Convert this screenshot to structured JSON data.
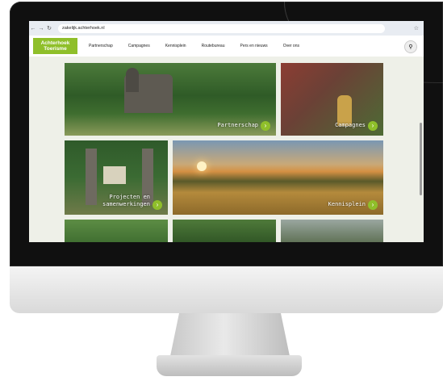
{
  "browser": {
    "url": "zakelijk.achterhoek.nl",
    "back_icon": "arrow-left",
    "forward_icon": "arrow-right",
    "reload_icon": "reload",
    "bookmark_icon": "star"
  },
  "site": {
    "logo_line1": "Achterhoek",
    "logo_line2": "Toerisme",
    "brand_color": "#8fbf2a",
    "menu": [
      {
        "label": "Partnerschap"
      },
      {
        "label": "Campagnes"
      },
      {
        "label": "Kennisplein"
      },
      {
        "label": "Routebureau"
      },
      {
        "label": "Pers en nieuws"
      },
      {
        "label": "Over ons"
      }
    ],
    "search_icon": "search"
  },
  "tiles": [
    {
      "label": "Partnerschap"
    },
    {
      "label": "Campagnes"
    },
    {
      "label": "Projecten en samenwerkingen"
    },
    {
      "label": "Kennisplein"
    }
  ]
}
